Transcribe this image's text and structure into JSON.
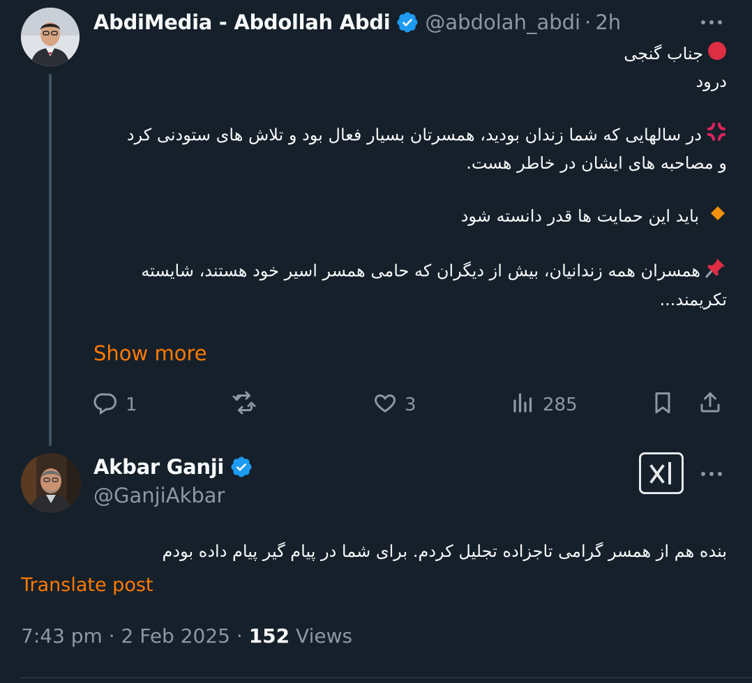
{
  "parent": {
    "display_name": "AbdiMedia - Abdollah Abdi",
    "handle": "@abdolah_abdi",
    "separator": "·",
    "time": "2h",
    "lines": [
      "جناب گنجی",
      "درود",
      "در سالهایی که شما زندان بودید، همسرتان بسیار فعال بود و تلاش های ستودنی کرد",
      "و مصاحبه های ایشان در خاطر هست.",
      "باید این حمایت ها قدر دانسته شود",
      "همسران همه زندانیان، بیش از دیگران که حامی همسر اسیر خود هستند، شایسته",
      "تکریمند..."
    ],
    "show_more": "Show more",
    "stats": {
      "replies": "1",
      "reposts": "",
      "likes": "3",
      "views": "285"
    }
  },
  "main": {
    "display_name": "Akbar Ganji",
    "handle": "@GanjiAkbar",
    "text": "بنده هم از همسر گرامی تاجزاده تجلیل کردم. برای شما در پیام گیر پیام داده بودم",
    "translate": "Translate post",
    "timestamp": "7:43 pm · 2 Feb 2025 · ",
    "views_count": "152",
    "views_label": " Views"
  },
  "icons": {
    "verified": "verified-badge-icon",
    "more": "more-dots-icon",
    "reply": "reply-icon",
    "repost": "repost-icon",
    "like": "heart-icon",
    "views": "views-chart-icon",
    "bookmark": "bookmark-icon",
    "share": "share-icon",
    "grok": "grok-icon"
  },
  "colors": {
    "background": "#15202b",
    "accent": "#ff7a00",
    "verified": "#1d9bf0",
    "muted": "#8b98a5"
  }
}
